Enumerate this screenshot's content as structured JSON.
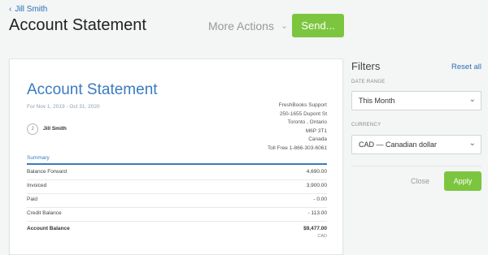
{
  "header": {
    "back_label": "Jill Smith",
    "title": "Account Statement",
    "more_actions": "More Actions",
    "send_label": "Send..."
  },
  "statement": {
    "title": "Account Statement",
    "date_range": "For Nov 1, 2019 - Oct 31, 2020",
    "company": {
      "name": "FreshBooks Support",
      "street": "250-1655 Dupont St",
      "city": "Toronto , Ontario",
      "postal": "M6P 3T1",
      "country": "Canada",
      "phone": "Toll Free 1-866-303-6061"
    },
    "client": {
      "initial": "J",
      "name": "Jill Smith"
    },
    "summary_label": "Summary",
    "rows": [
      {
        "label": "Balance Forward",
        "value": "4,690.00"
      },
      {
        "label": "Invoiced",
        "value": "3,900.00"
      },
      {
        "label": "Paid",
        "value": "- 0.00"
      },
      {
        "label": "Credit Balance",
        "value": "- 113.00"
      }
    ],
    "total": {
      "label": "Account Balance",
      "value": "$9,477.00",
      "currency": "CAD"
    }
  },
  "filters": {
    "title": "Filters",
    "reset_label": "Reset all",
    "date_range_label": "DATE RANGE",
    "date_range_value": "This Month",
    "currency_label": "CURRENCY",
    "currency_value": "CAD — Canadian dollar",
    "close_label": "Close",
    "apply_label": "Apply"
  },
  "colors": {
    "accent_blue": "#3a7bbf",
    "link_blue": "#2a6fb6",
    "green_button": "#7cc63f"
  }
}
